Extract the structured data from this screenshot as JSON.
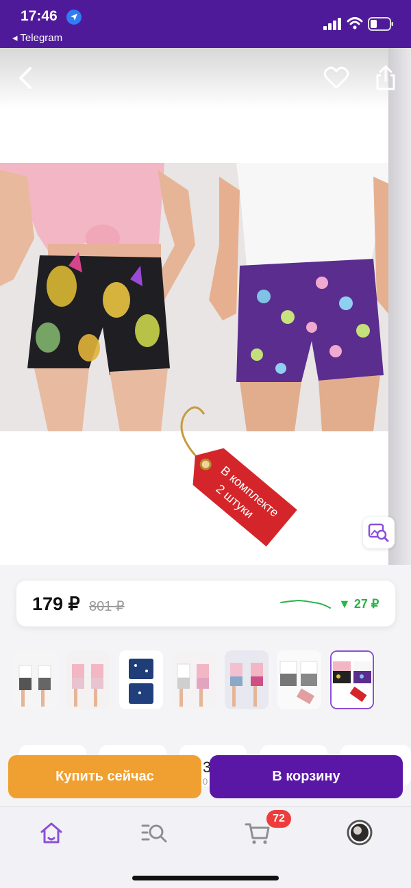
{
  "status_bar": {
    "time": "17:46",
    "back_app_label": "◂ Telegram"
  },
  "product": {
    "tag_line1": "В комплекте",
    "tag_line2": "2 штуки"
  },
  "price": {
    "current": "179 ₽",
    "old": "801 ₽",
    "drop": "▼ 27 ₽"
  },
  "thumbnails": [
    {
      "name": "thumb-1"
    },
    {
      "name": "thumb-2"
    },
    {
      "name": "thumb-3"
    },
    {
      "name": "thumb-4"
    },
    {
      "name": "thumb-5"
    },
    {
      "name": "thumb-6"
    },
    {
      "name": "thumb-7",
      "selected": true
    }
  ],
  "options_partial": {
    "text1": "3",
    "text2": "0"
  },
  "actions": {
    "buy_now": "Купить сейчас",
    "add_to_cart": "В корзину"
  },
  "tab_bar": {
    "items": [
      {
        "name": "home",
        "icon": "home-icon",
        "active": true
      },
      {
        "name": "catalog",
        "icon": "catalog-search-icon"
      },
      {
        "name": "cart",
        "icon": "cart-icon"
      },
      {
        "name": "profile",
        "icon": "avatar"
      }
    ],
    "cart_badge": "72"
  },
  "colors": {
    "brand_purple": "#5a17a6",
    "buy_orange": "#f0a030",
    "price_drop_green": "#2db34a",
    "badge_red": "#ee3b3b"
  }
}
